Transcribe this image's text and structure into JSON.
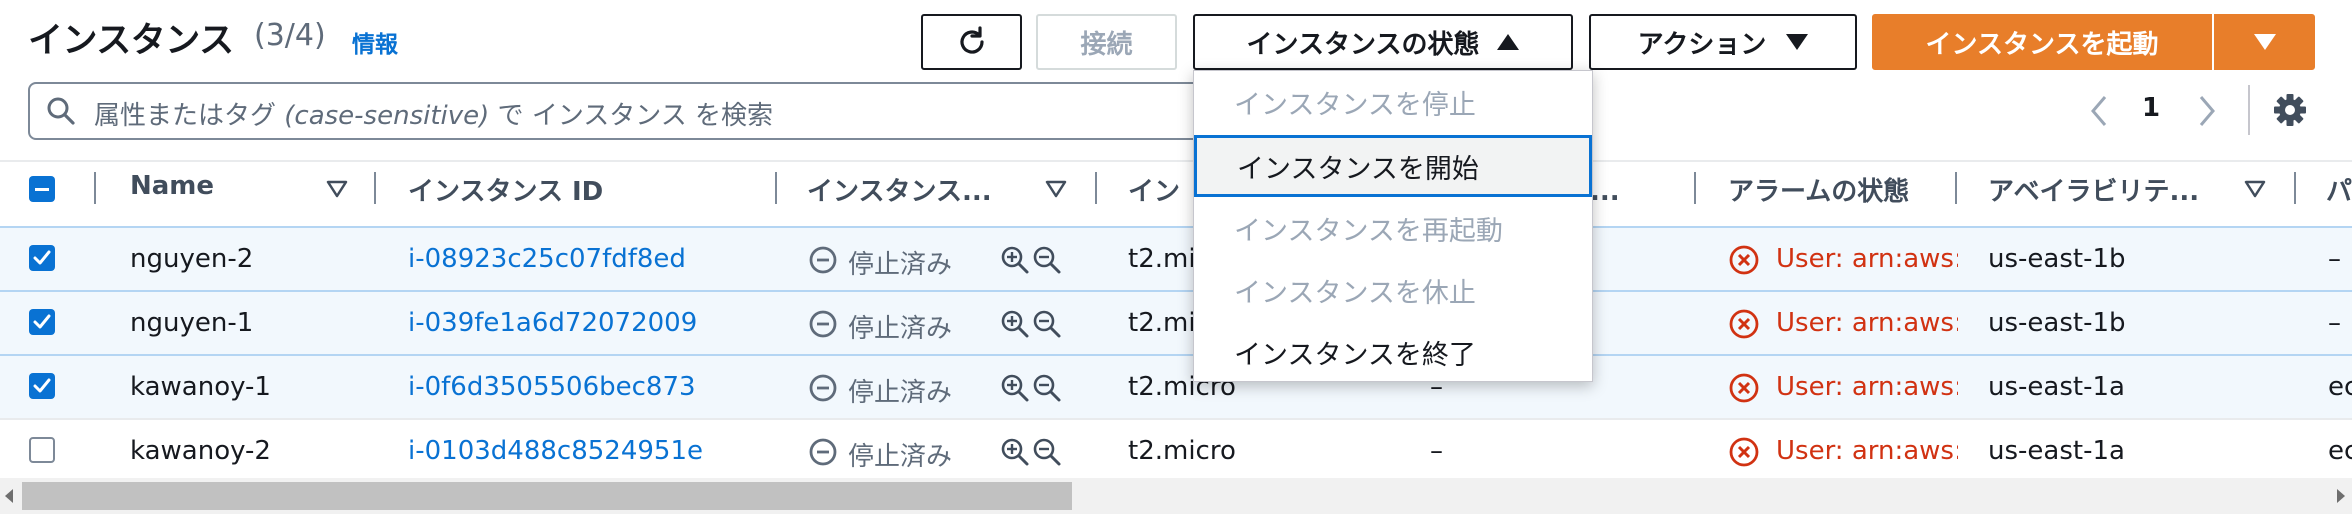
{
  "header": {
    "title": "インスタンス",
    "count": "(3/4)",
    "info_link": "情報"
  },
  "toolbar": {
    "connect_label": "接続",
    "instance_state_label": "インスタンスの状態",
    "actions_label": "アクション",
    "launch_label": "インスタンスを起動"
  },
  "search": {
    "placeholder_pre": "属性またはタグ ",
    "placeholder_italic": "(case-sensitive)",
    "placeholder_post": " で インスタンス を検索"
  },
  "pagination": {
    "current_page": "1"
  },
  "table": {
    "columns": [
      "Name",
      "インスタンス ID",
      "インスタンス...",
      "イン",
      "チェ...",
      "アラームの状態",
      "アベイラビリテ...",
      "パ"
    ],
    "rows": [
      {
        "checked": true,
        "name": "nguyen-2",
        "instance_id": "i-08923c25c07fdf8ed",
        "state": "停止済み",
        "type": "t2.mi",
        "status_check": "",
        "alarm": "User: arn:aws:i",
        "az": "us-east-1b",
        "extra": "–"
      },
      {
        "checked": true,
        "name": "nguyen-1",
        "instance_id": "i-039fe1a6d72072009",
        "state": "停止済み",
        "type": "t2.mi",
        "status_check": "",
        "alarm": "User: arn:aws:i",
        "az": "us-east-1b",
        "extra": "–"
      },
      {
        "checked": true,
        "name": "kawanoy-1",
        "instance_id": "i-0f6d3505506bec873",
        "state": "停止済み",
        "type": "t2.micro",
        "status_check": "–",
        "alarm": "User: arn:aws:i",
        "az": "us-east-1a",
        "extra": "ec"
      },
      {
        "checked": false,
        "name": "kawanoy-2",
        "instance_id": "i-0103d488c8524951e",
        "state": "停止済み",
        "type": "t2.micro",
        "status_check": "–",
        "alarm": "User: arn:aws:i",
        "az": "us-east-1a",
        "extra": "ec"
      }
    ]
  },
  "state_menu": {
    "items": [
      {
        "label": "インスタンスを停止",
        "disabled": true
      },
      {
        "label": "インスタンスを開始",
        "disabled": false
      },
      {
        "label": "インスタンスを再起動",
        "disabled": true
      },
      {
        "label": "インスタンスを休止",
        "disabled": true
      },
      {
        "label": "インスタンスを終了",
        "disabled": false
      }
    ]
  },
  "colors": {
    "accent": "#0972d3",
    "launch": "#e87e2a",
    "alarm": "#d13212",
    "selected_row": "#f2f8fd"
  },
  "icons": [
    "refresh-icon",
    "caret-up-icon",
    "caret-down-icon",
    "search-icon",
    "chevron-left-icon",
    "chevron-right-icon",
    "gear-icon",
    "filter-caret-icon",
    "stopped-icon",
    "zoom-in-icon",
    "zoom-out-icon",
    "alarm-error-icon"
  ]
}
